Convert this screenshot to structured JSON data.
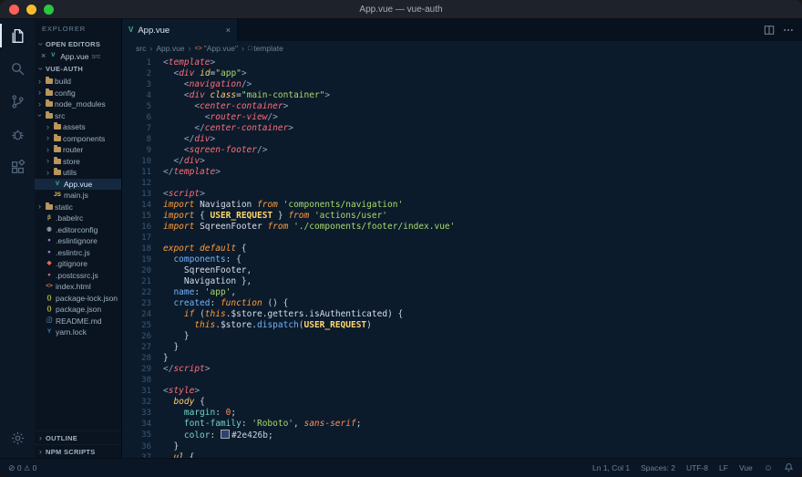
{
  "window": {
    "title": "App.vue — vue-auth",
    "traffic_lights": [
      "#ff5f57",
      "#febc2e",
      "#28c840"
    ]
  },
  "activity_bar": {
    "top": [
      "explorer",
      "search",
      "source-control",
      "debug",
      "extensions"
    ],
    "bottom": [
      "settings"
    ],
    "active": "explorer"
  },
  "sidebar": {
    "title": "EXPLORER",
    "open_editors": {
      "label": "OPEN EDITORS",
      "file": {
        "name": "App.vue",
        "detail": "src",
        "icon": "vue"
      }
    },
    "project": {
      "label": "VUE-AUTH",
      "tree": [
        {
          "label": "build",
          "icon": "folder",
          "level": 1,
          "chevron": "collapsed"
        },
        {
          "label": "config",
          "icon": "folder",
          "level": 1,
          "chevron": "collapsed"
        },
        {
          "label": "node_modules",
          "icon": "folder",
          "level": 1,
          "chevron": "collapsed"
        },
        {
          "label": "src",
          "icon": "folder-open",
          "level": 1,
          "chevron": "expanded"
        },
        {
          "label": "assets",
          "icon": "folder",
          "level": 2,
          "chevron": "collapsed"
        },
        {
          "label": "components",
          "icon": "folder",
          "level": 2,
          "chevron": "collapsed"
        },
        {
          "label": "router",
          "icon": "folder",
          "level": 2,
          "chevron": "collapsed"
        },
        {
          "label": "store",
          "icon": "folder",
          "level": 2,
          "chevron": "collapsed"
        },
        {
          "label": "utils",
          "icon": "folder",
          "level": 2,
          "chevron": "collapsed"
        },
        {
          "label": "App.vue",
          "icon": "vue",
          "level": 2,
          "selected": true
        },
        {
          "label": "main.js",
          "icon": "js",
          "level": 2
        },
        {
          "label": "static",
          "icon": "folder",
          "level": 1,
          "chevron": "collapsed"
        },
        {
          "label": ".babelrc",
          "icon": "babel",
          "level": 1
        },
        {
          "label": ".editorconfig",
          "icon": "editorconfig",
          "level": 1
        },
        {
          "label": ".eslintignore",
          "icon": "eslint",
          "level": 1
        },
        {
          "label": ".eslintrc.js",
          "icon": "eslint",
          "level": 1
        },
        {
          "label": ".gitignore",
          "icon": "git",
          "level": 1
        },
        {
          "label": ".postcssrc.js",
          "icon": "postcss",
          "level": 1
        },
        {
          "label": "index.html",
          "icon": "html",
          "level": 1
        },
        {
          "label": "package-lock.json",
          "icon": "json",
          "level": 1
        },
        {
          "label": "package.json",
          "icon": "json",
          "level": 1
        },
        {
          "label": "README.md",
          "icon": "readme",
          "level": 1
        },
        {
          "label": "yarn.lock",
          "icon": "yarn",
          "level": 1
        }
      ]
    },
    "outline": {
      "label": "OUTLINE"
    },
    "npm_scripts": {
      "label": "NPM SCRIPTS"
    }
  },
  "file_icons": {
    "vue": {
      "glyph": "V",
      "color": "#41b883"
    },
    "js": {
      "glyph": "JS",
      "color": "#e8c64e"
    },
    "folder": {
      "glyph": "",
      "color": "#b9965c"
    },
    "babel": {
      "glyph": "β",
      "color": "#c9b458"
    },
    "editorconfig": {
      "glyph": "◉",
      "color": "#8f9da8"
    },
    "eslint": {
      "glyph": "●",
      "color": "#9b7cc8"
    },
    "git": {
      "glyph": "◆",
      "color": "#e8694f"
    },
    "postcss": {
      "glyph": "●",
      "color": "#d65b86"
    },
    "html": {
      "glyph": "<>",
      "color": "#e07b53"
    },
    "json": {
      "glyph": "{}",
      "color": "#cbcb41"
    },
    "readme": {
      "glyph": "ⓘ",
      "color": "#4f9fcf"
    },
    "yarn": {
      "glyph": "Y",
      "color": "#2c8ebb"
    }
  },
  "editor": {
    "tab": {
      "title": "App.vue",
      "icon": "vue"
    },
    "breadcrumb": [
      {
        "label": "src"
      },
      {
        "label": "App.vue"
      },
      {
        "label": "\"App.vue\"",
        "icon_glyph": "<>",
        "icon_color": "#d8824a",
        "icon_name": "symbol-code-icon"
      },
      {
        "label": "template",
        "icon_glyph": "□",
        "icon_color": "#6b8095",
        "icon_name": "symbol-template-icon"
      }
    ],
    "code_lines": [
      [
        [
          "br",
          "<"
        ],
        [
          "tag",
          "template"
        ],
        [
          "br",
          ">"
        ]
      ],
      [
        [
          "fg",
          "  "
        ],
        [
          "br",
          "<"
        ],
        [
          "tag",
          "div"
        ],
        [
          "fg",
          " "
        ],
        [
          "attr",
          "id"
        ],
        [
          "fg",
          "="
        ],
        [
          "str",
          "\"app\""
        ],
        [
          "br",
          ">"
        ]
      ],
      [
        [
          "fg",
          "    "
        ],
        [
          "br",
          "<"
        ],
        [
          "tag",
          "navigation"
        ],
        [
          "br",
          "/>"
        ]
      ],
      [
        [
          "fg",
          "    "
        ],
        [
          "br",
          "<"
        ],
        [
          "tag",
          "div"
        ],
        [
          "fg",
          " "
        ],
        [
          "attr",
          "class"
        ],
        [
          "fg",
          "="
        ],
        [
          "str",
          "\"main-container\""
        ],
        [
          "br",
          ">"
        ]
      ],
      [
        [
          "fg",
          "      "
        ],
        [
          "br",
          "<"
        ],
        [
          "tag",
          "center-container"
        ],
        [
          "br",
          ">"
        ]
      ],
      [
        [
          "fg",
          "        "
        ],
        [
          "br",
          "<"
        ],
        [
          "tag",
          "router-view"
        ],
        [
          "br",
          "/>"
        ]
      ],
      [
        [
          "fg",
          "      "
        ],
        [
          "br",
          "</"
        ],
        [
          "tag",
          "center-container"
        ],
        [
          "br",
          ">"
        ]
      ],
      [
        [
          "fg",
          "    "
        ],
        [
          "br",
          "</"
        ],
        [
          "tag",
          "div"
        ],
        [
          "br",
          ">"
        ]
      ],
      [
        [
          "fg",
          "    "
        ],
        [
          "br",
          "<"
        ],
        [
          "tag",
          "sqreen-footer"
        ],
        [
          "br",
          "/>"
        ]
      ],
      [
        [
          "fg",
          "  "
        ],
        [
          "br",
          "</"
        ],
        [
          "tag",
          "div"
        ],
        [
          "br",
          ">"
        ]
      ],
      [
        [
          "br",
          "</"
        ],
        [
          "tag",
          "template"
        ],
        [
          "br",
          ">"
        ]
      ],
      [],
      [
        [
          "br",
          "<"
        ],
        [
          "tag",
          "script"
        ],
        [
          "br",
          ">"
        ]
      ],
      [
        [
          "kw",
          "import"
        ],
        [
          "fg",
          " "
        ],
        [
          "ident",
          "Navigation"
        ],
        [
          "fg",
          " "
        ],
        [
          "kw",
          "from"
        ],
        [
          "fg",
          " "
        ],
        [
          "str",
          "'components/navigation'"
        ]
      ],
      [
        [
          "kw",
          "import"
        ],
        [
          "fg",
          " { "
        ],
        [
          "cons",
          "USER_REQUEST"
        ],
        [
          "fg",
          " } "
        ],
        [
          "kw",
          "from"
        ],
        [
          "fg",
          " "
        ],
        [
          "str",
          "'actions/user'"
        ]
      ],
      [
        [
          "kw",
          "import"
        ],
        [
          "fg",
          " "
        ],
        [
          "ident",
          "SqreenFooter"
        ],
        [
          "fg",
          " "
        ],
        [
          "kw",
          "from"
        ],
        [
          "fg",
          " "
        ],
        [
          "str",
          "'./components/footer/index.vue'"
        ]
      ],
      [],
      [
        [
          "kw",
          "export default"
        ],
        [
          "fg",
          " {"
        ]
      ],
      [
        [
          "fg",
          "  "
        ],
        [
          "prop",
          "components"
        ],
        [
          "fg",
          ": {"
        ]
      ],
      [
        [
          "fg",
          "    "
        ],
        [
          "ident",
          "SqreenFooter"
        ],
        [
          "fg",
          ","
        ]
      ],
      [
        [
          "fg",
          "    "
        ],
        [
          "ident",
          "Navigation"
        ],
        [
          "fg",
          " },"
        ]
      ],
      [
        [
          "fg",
          "  "
        ],
        [
          "prop",
          "name"
        ],
        [
          "fg",
          ": "
        ],
        [
          "str",
          "'app'"
        ],
        [
          "fg",
          ","
        ]
      ],
      [
        [
          "fg",
          "  "
        ],
        [
          "prop",
          "created"
        ],
        [
          "fg",
          ": "
        ],
        [
          "kw",
          "function"
        ],
        [
          "fg",
          " () {"
        ]
      ],
      [
        [
          "fg",
          "    "
        ],
        [
          "kw",
          "if"
        ],
        [
          "fg",
          " ("
        ],
        [
          "kw",
          "this"
        ],
        [
          "fg",
          "."
        ],
        [
          "ident",
          "$store"
        ],
        [
          "fg",
          "."
        ],
        [
          "ident",
          "getters"
        ],
        [
          "fg",
          "."
        ],
        [
          "ident",
          "isAuthenticated"
        ],
        [
          "fg",
          ") {"
        ]
      ],
      [
        [
          "fg",
          "      "
        ],
        [
          "kw",
          "this"
        ],
        [
          "fg",
          "."
        ],
        [
          "ident",
          "$store"
        ],
        [
          "fg",
          "."
        ],
        [
          "func",
          "dispatch"
        ],
        [
          "fg",
          "("
        ],
        [
          "cons",
          "USER_REQUEST"
        ],
        [
          "fg",
          ")"
        ]
      ],
      [
        [
          "fg",
          "    }"
        ]
      ],
      [
        [
          "fg",
          "  }"
        ]
      ],
      [
        [
          "fg",
          "}"
        ]
      ],
      [
        [
          "br",
          "</"
        ],
        [
          "tag",
          "script"
        ],
        [
          "br",
          ">"
        ]
      ],
      [],
      [
        [
          "br",
          "<"
        ],
        [
          "tag",
          "style"
        ],
        [
          "br",
          ">"
        ]
      ],
      [
        [
          "fg",
          "  "
        ],
        [
          "csssel",
          "body"
        ],
        [
          "fg",
          " {"
        ]
      ],
      [
        [
          "fg",
          "    "
        ],
        [
          "cssprop",
          "margin"
        ],
        [
          "fg",
          ": "
        ],
        [
          "num",
          "0"
        ],
        [
          "fg",
          ";"
        ]
      ],
      [
        [
          "fg",
          "    "
        ],
        [
          "cssprop",
          "font-family"
        ],
        [
          "fg",
          ": "
        ],
        [
          "str",
          "'Roboto'"
        ],
        [
          "fg",
          ", "
        ],
        [
          "cssval",
          "sans-serif"
        ],
        [
          "fg",
          ";"
        ]
      ],
      [
        [
          "fg",
          "    "
        ],
        [
          "cssprop",
          "color"
        ],
        [
          "fg",
          ": "
        ],
        [
          "swatch",
          "#2e426b"
        ],
        [
          "fg",
          "#2e426b;"
        ]
      ],
      [
        [
          "fg",
          "  }"
        ]
      ],
      [
        [
          "fg",
          "  "
        ],
        [
          "csssel",
          "ul"
        ],
        [
          "fg",
          " {"
        ]
      ]
    ]
  },
  "status_bar": {
    "errors": "0",
    "warnings": "0",
    "items": [
      "Ln 1, Col 1",
      "Spaces: 2",
      "UTF-8",
      "LF",
      "Vue"
    ]
  },
  "colors": {
    "vue_green": "#41b883",
    "code_color_swatch": "#2e426b"
  }
}
